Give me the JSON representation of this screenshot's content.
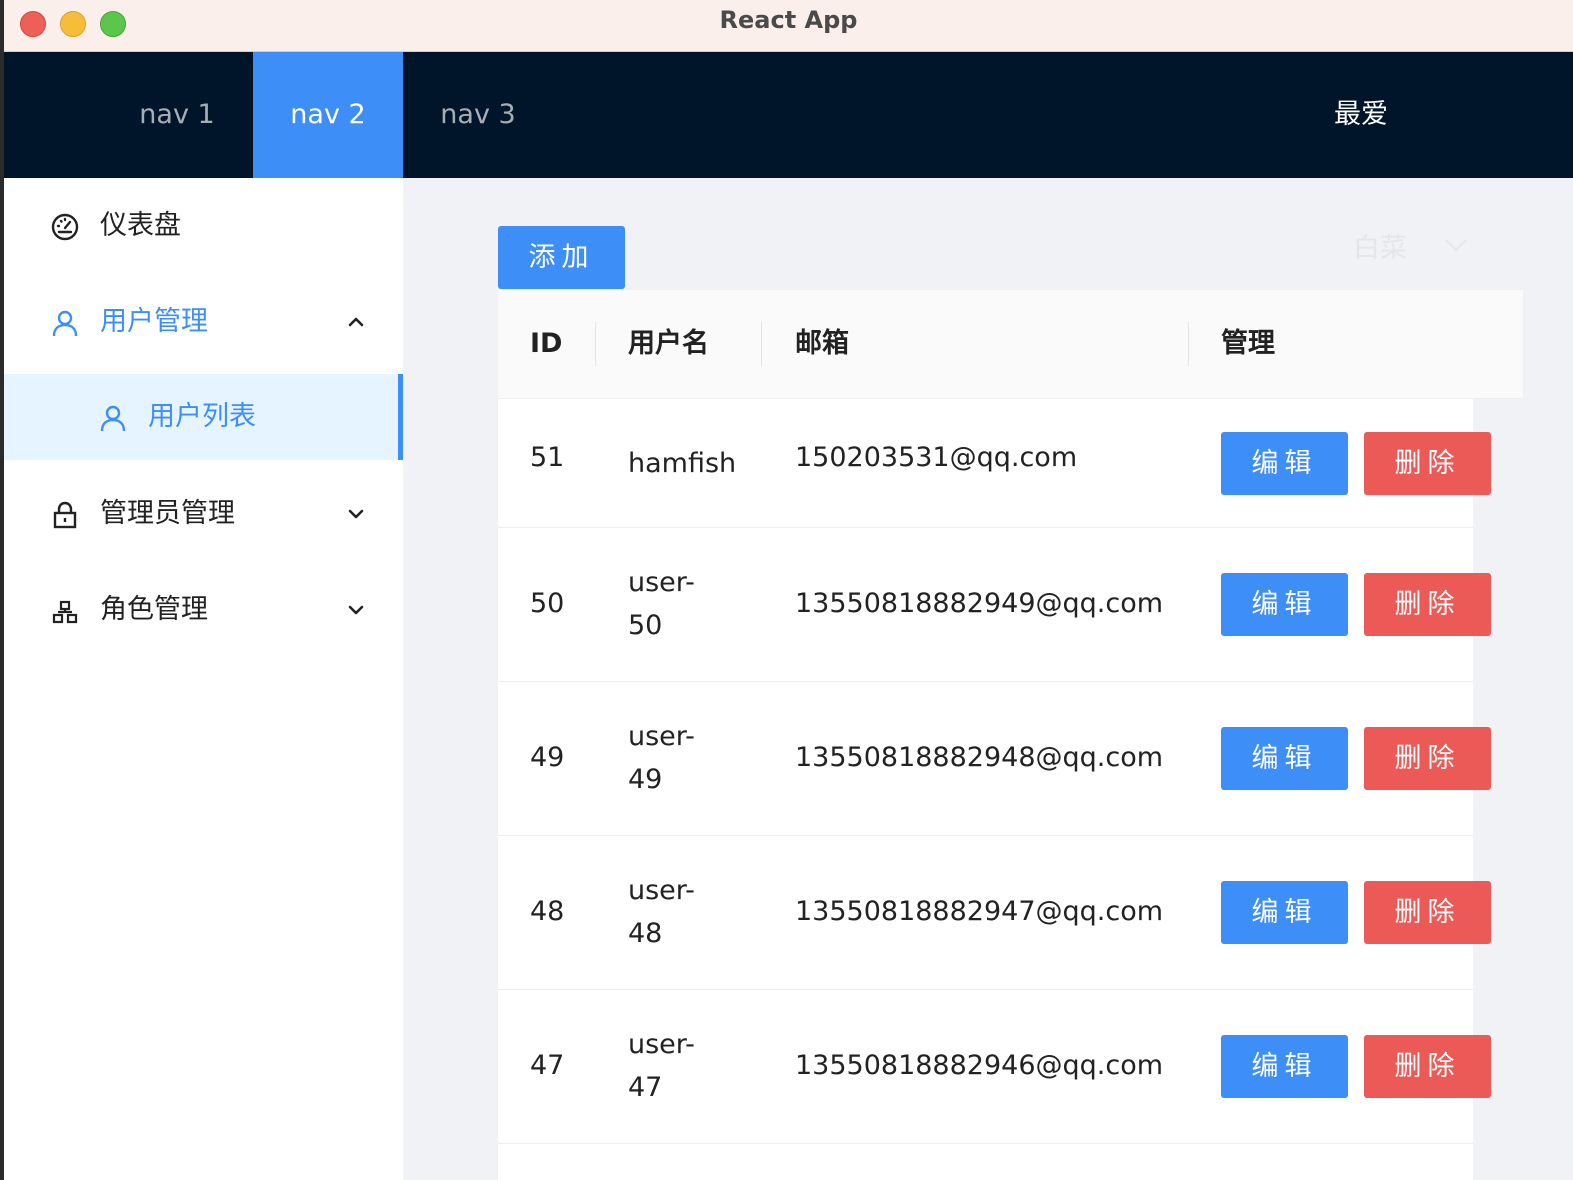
{
  "window": {
    "title": "React App"
  },
  "topnav": {
    "items": [
      {
        "label": "nav 1"
      },
      {
        "label": "nav 2"
      },
      {
        "label": "nav 3"
      }
    ],
    "active_index": 1,
    "right_label": "最爱"
  },
  "sidebar": {
    "items": [
      {
        "label": "仪表盘",
        "icon": "dashboard-icon"
      },
      {
        "label": "用户管理",
        "icon": "user-icon",
        "expanded": true
      },
      {
        "label": "管理员管理",
        "icon": "lock-icon",
        "expanded": false
      },
      {
        "label": "角色管理",
        "icon": "cluster-icon",
        "expanded": false
      }
    ],
    "subitem": {
      "label": "用户列表",
      "icon": "user-icon",
      "selected": true
    }
  },
  "toolbar": {
    "add_label": "添加",
    "dropdown_value": "白菜"
  },
  "table": {
    "columns": [
      "ID",
      "用户名",
      "邮箱",
      "管理"
    ],
    "rows": [
      {
        "id": "51",
        "name_lines": [
          "hamfish"
        ],
        "email": "150203531@qq.com",
        "edit": "编辑",
        "delete": "删除"
      },
      {
        "id": "50",
        "name_lines": [
          "user-",
          "50"
        ],
        "email": "13550818882949@qq.com",
        "edit": "编辑",
        "delete": "删除"
      },
      {
        "id": "49",
        "name_lines": [
          "user-",
          "49"
        ],
        "email": "13550818882948@qq.com",
        "edit": "编辑",
        "delete": "删除"
      },
      {
        "id": "48",
        "name_lines": [
          "user-",
          "48"
        ],
        "email": "13550818882947@qq.com",
        "edit": "编辑",
        "delete": "删除"
      },
      {
        "id": "47",
        "name_lines": [
          "user-",
          "47"
        ],
        "email": "13550818882946@qq.com",
        "edit": "编辑",
        "delete": "删除"
      }
    ]
  },
  "colors": {
    "primary": "#3e8ef7",
    "danger": "#ec5a57",
    "nav_bg": "#001529",
    "content_bg": "#f0f2f5"
  }
}
